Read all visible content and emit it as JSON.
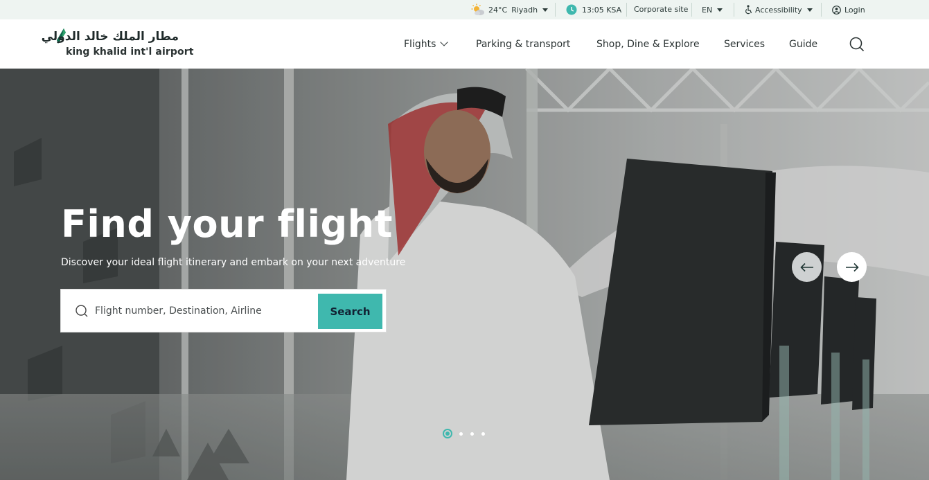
{
  "utility_bar": {
    "weather": {
      "icon": "partly-sunny-icon",
      "temperature": "24°C",
      "city": "Riyadh"
    },
    "time": {
      "icon": "clock-icon",
      "value": "13:05 KSA"
    },
    "corporate_link": "Corporate site",
    "language": "EN",
    "accessibility": {
      "icon": "accessibility-icon",
      "label": "Accessibility"
    },
    "login": {
      "icon": "user-circle-icon",
      "label": "Login"
    }
  },
  "header": {
    "logo": {
      "arabic": "مطار الملك خالد الدولي",
      "english": "king khalid int'l airport"
    },
    "nav": [
      "Flights",
      "Parking & transport",
      "Shop, Dine & Explore",
      "Services",
      "Guide"
    ],
    "search_icon": "search-icon"
  },
  "hero": {
    "title": "Find your flight",
    "subtitle": "Discover your ideal flight itinerary and embark on your next adventure",
    "search": {
      "placeholder": "Flight number, Destination, Airline",
      "button_label": "Search"
    },
    "carousel": {
      "prev_icon": "arrow-left-icon",
      "next_icon": "arrow-right-icon",
      "slide_count": 4,
      "active_slide": 1
    }
  },
  "colors": {
    "accent": "#3fb8ae",
    "utility_bg": "#eef4f1",
    "text_dark": "#2a3232"
  }
}
